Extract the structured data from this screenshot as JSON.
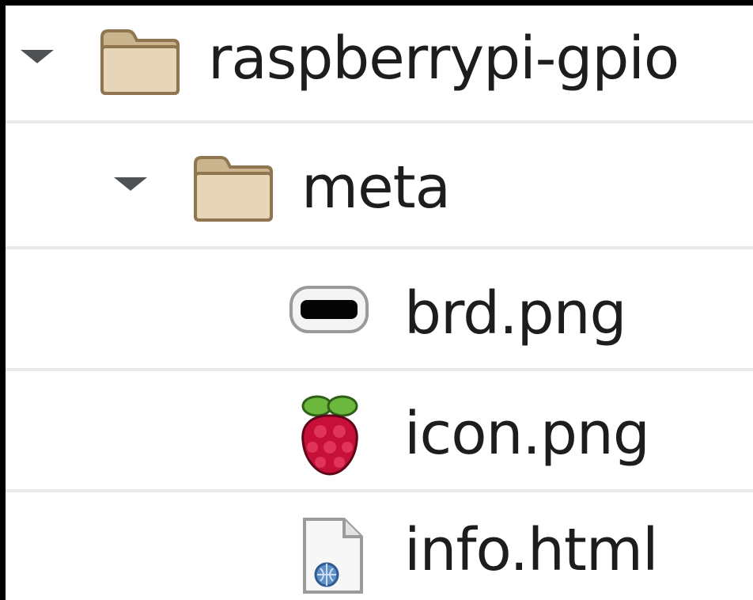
{
  "file_tree": {
    "items": [
      {
        "name": "raspberrypi-gpio",
        "type": "folder",
        "expanded": true,
        "icon": "folder-icon",
        "depth": 0
      },
      {
        "name": "meta",
        "type": "folder",
        "expanded": true,
        "icon": "folder-icon",
        "depth": 1
      },
      {
        "name": "brd.png",
        "type": "file",
        "icon": "image-file-icon",
        "depth": 2
      },
      {
        "name": "icon.png",
        "type": "file",
        "icon": "raspberry-icon",
        "depth": 2
      },
      {
        "name": "info.html",
        "type": "file",
        "icon": "html-file-icon",
        "depth": 2
      }
    ]
  },
  "colors": {
    "folder_fill": "#e3d2b2",
    "folder_stroke": "#8f7550",
    "raspberry_red": "#c6103a",
    "raspberry_leaf": "#6bb83c",
    "separator": "#e8e9eb",
    "text": "#1d1d1d"
  }
}
